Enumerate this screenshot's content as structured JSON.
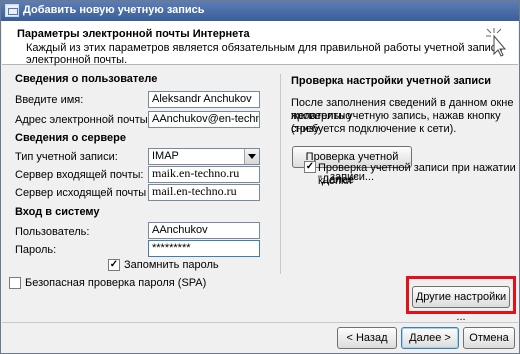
{
  "window": {
    "title": "Добавить новую учетную запись"
  },
  "header": {
    "title": "Параметры электронной почты Интернета",
    "subtitle": "Каждый из этих параметров является обязательным для правильной работы учетной записи электронной почты."
  },
  "user_info": {
    "heading": "Сведения о пользователе",
    "name_label": "Введите имя:",
    "name_value": "Aleksandr Anchukov",
    "email_label": "Адрес электронной почты:",
    "email_value": "AAnchukov@en-techno.ru"
  },
  "server_info": {
    "heading": "Сведения о сервере",
    "type_label": "Тип учетной записи:",
    "type_value": "IMAP",
    "incoming_label": "Сервер входящей почты:",
    "incoming_value": "maik.en-techno.ru",
    "outgoing_label": "Сервер исходящей почты (SMTP):",
    "outgoing_value": "mail.en-techno.ru"
  },
  "logon": {
    "heading": "Вход в систему",
    "user_label": "Пользователь:",
    "user_value": "AAnchukov",
    "password_label": "Пароль:",
    "password_value": "*********",
    "remember_label": "Запомнить пароль",
    "remember_checked": true,
    "spa_label": "Безопасная проверка пароля (SPA)",
    "spa_checked": false
  },
  "test": {
    "heading": "Проверка настройки учетной записи",
    "line1": "После заполнения сведений в данном окне желательно",
    "line2": "проверить учетную запись, нажав кнопку снизу",
    "line3": "(требуется подключение к сети).",
    "test_button": "Проверка учетной записи...",
    "auto_line1": "Проверка учетной записи при нажатии кнопки",
    "auto_line2": "\"Далее\"",
    "auto_checked": true,
    "more_button": "Другие настройки ..."
  },
  "nav": {
    "back": "< Назад",
    "next": "Далее >",
    "cancel": "Отмена"
  },
  "colors": {
    "highlight": "#e4101a"
  }
}
